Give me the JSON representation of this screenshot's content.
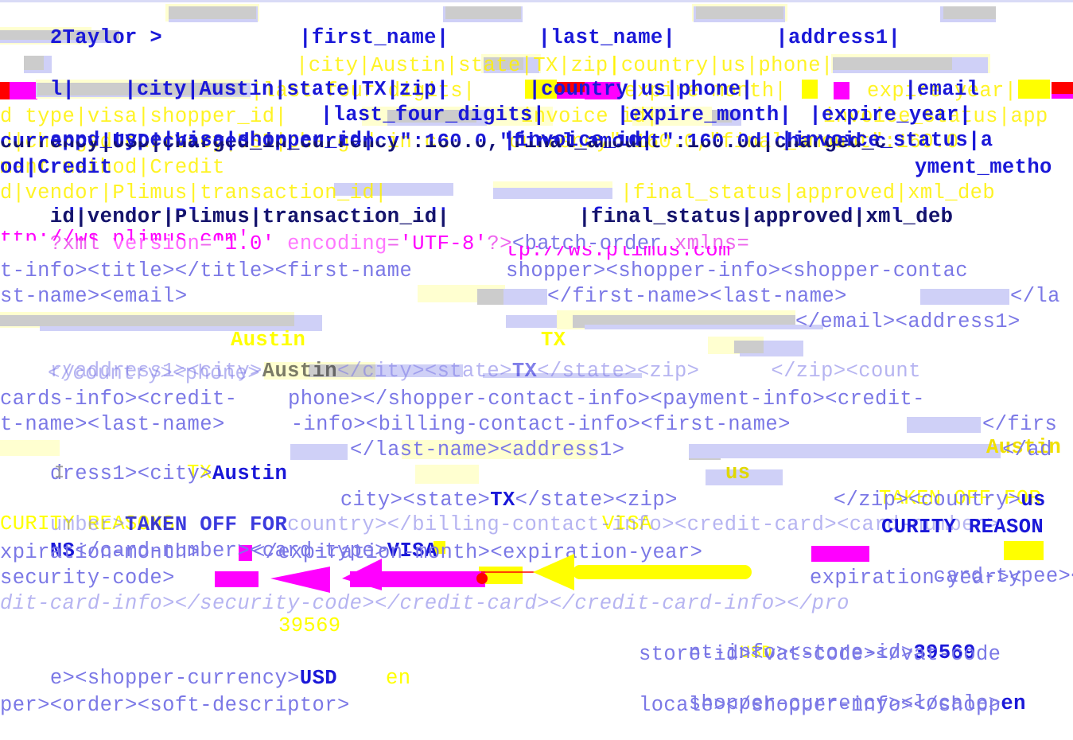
{
  "record": {
    "line1": {
      "prefix": "2Taylor >",
      "k1": "|first_name|",
      "k2": "|last_name|",
      "k3": "|address1|"
    },
    "line2": {
      "lead": "l|",
      "ghost": "|c",
      "text": "|city|Austin|state|TX|zip|",
      "ghost2": "|c",
      "text2": "|country|us|phone|",
      "ghost3": "|e",
      "text3": "|email"
    },
    "line3": {
      "text": "|last_four_digits|",
      "ghost": "|e",
      "text2": "|expire_month|",
      "ghost2": "e",
      "text3": "|expire_year|"
    },
    "line4": {
      "text": "appd_type|visa|shopper_id|",
      "ghost": "|i",
      "text2": "|invoice_id|",
      "ghost2": "|i",
      "text3": "|invoice_status|a"
    },
    "line5": {
      "text": "currency|USD|charged_in_currency\":160.0,\"final_amount\":160.0d|charged_c"
    },
    "line6": {
      "text": "od|Credit",
      "ghost": "ment method|Credit",
      "right": "yment_metho"
    },
    "line7": {
      "text": "id|vendor|Plimus|transaction_id|",
      "text2": "|final_status|approved|xml_deb"
    },
    "ghost_lines": {
      "g4": "d type|visa|shopper_id|",
      "g4b": "invoice id|",
      "g4c": "invoice_status|app",
      "g5": "d|charged currency|USD|charged in cu",
      "g5b": "currency\":160.0,\"final_amount\":160.0",
      "g7": "d|vendor|Plimus|transaction_id|",
      "g7b": "|final_status|approved|xml_deb",
      "g3": "|last four digits|",
      "g3b": "expire month|",
      "g3c": "expire year|",
      "g2": "|city|Austin|state|TX|zip|",
      "g2b": "|country|us|phone|"
    }
  },
  "xml": {
    "decl_q": "?xml ",
    "decl_version_attr": "version",
    "decl_eq": "=",
    "decl_version_val": "'1.0'",
    "decl_encoding_attr": " encoding",
    "decl_encoding_val": "'UTF-8'",
    "decl_end": "?>",
    "batch_open": "<batch-order ",
    "xmlns": "xmlns",
    "xmlns_eq": "=",
    "url_left": "ttp://ws.plimus.com'",
    "url_right": "tp://ws.plimus.com",
    "l3_left": "t-info><title></title><first-name",
    "l3_right": "shopper><shopper-info><shopper-contac",
    "l4_left": "st-name><email>",
    "l4_right": "</first-name><last-name>",
    "l4_right2": "</la",
    "l5_right": "</email><address1>",
    "l6_left": "ryaddress1><city>",
    "l6_austin": "Austin",
    "l6_mid": "</city><state>",
    "l6_tx": "TX",
    "l6_rest": "</state><zip>",
    "l6_rest2": "</zip><count",
    "l6_ghost_austin": "Austin",
    "l6_ghost_tx": "TX",
    "l7_ghost": "</country><phone>",
    "l8_left": "cards-info><credit-",
    "l8_right": "phone></shopper-contact-info><payment-info><credit-",
    "l9_left": "t-name><last-name>",
    "l9_right": " -info><billing-contact-info><first-name>",
    "l9_right2": "</firs",
    "l10_left": "dress1><city>",
    "l10_austin": "Austin",
    "l10_right": "</last-name><address1>",
    "l10_right2": "</ad",
    "l10_ghost": "Austin",
    "l11_ghost_tx": "TX",
    "l11_right": "city><state>",
    "l11_tx": "TX",
    "l11_right2": "</state><zip>",
    "l11_us_ghost": "us",
    "l11_right3": "</zip><country>",
    "l11_us": "us",
    "l12_left_garble": "umber>",
    "l12_taken": "TAKEN OFF FOR",
    "l12_garble": "country></billing-contact-info><credit-card><card-number>",
    "l12_ghost_taken": "TAKEN OFF FOR",
    "l13_ghost": "CURITY REASONS",
    "l13_ns": "NS",
    "l13_text": "</card-number><card-type>",
    "l13_visa": "VISA",
    "l13_ghost_visa": "VISA",
    "l13_right": "CURITY REASON",
    "l14_left": "xpiration-month>",
    "l14_mid": "</expiration-month><expiration-year>",
    "l14_right": " card-type",
    "l14_right2": "e><ex",
    "l15_left": "security-code>",
    "l15_right": "expiration-year><",
    "l16_garble": "dit-card-info></security-code></credit-card></credit-card-info></pro",
    "l17_ghost_id": "39569",
    "l17_right": "nt-info><store-id>",
    "l17_store": "39569",
    "l18_left": "e><shopper-currency>",
    "l18_usd": "USD",
    "l18_right": "store-id><vat-code></vat-code",
    "l18_ghost_usd": "USD",
    "l19_ghost_en": "en",
    "l19_right": "shopper-currency><locale>",
    "l19_en": "en",
    "l20_left": "per><order><soft-descriptor>",
    "l20_right": "locale></shopper-info></shopp"
  },
  "cursor": "I",
  "annotations": {
    "arrow_magenta": "pointer to security-code",
    "arrow_yellow": "pointer to security-code",
    "colors": {
      "magenta": "#ff00ff",
      "yellow": "#ffff00",
      "red": "#ff0000",
      "redaction_gray": "#cccccc",
      "redaction_lavender": "#cfd0f7",
      "text_blue": "#1a18d8",
      "xml_tag": "#7b78e6"
    }
  }
}
